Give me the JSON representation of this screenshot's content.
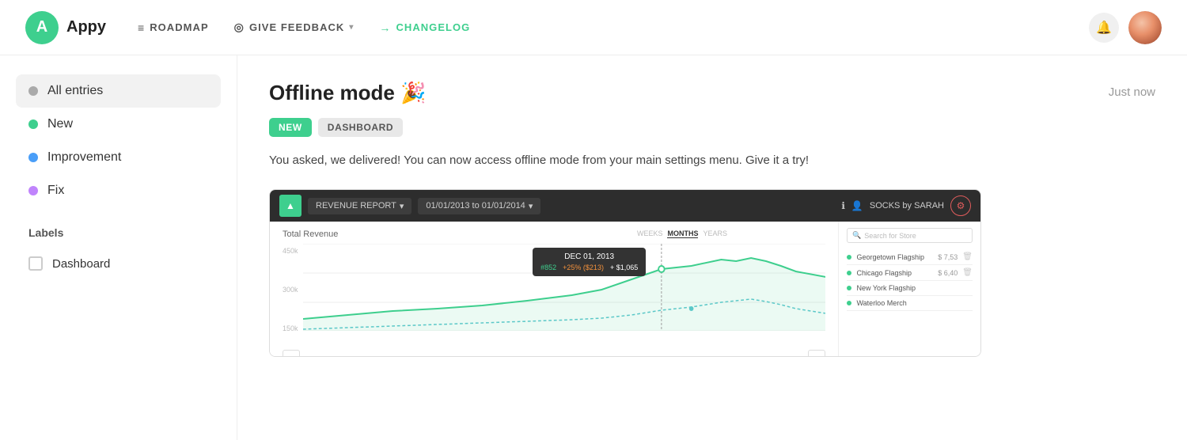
{
  "header": {
    "logo_letter": "A",
    "logo_name": "Appy",
    "nav": [
      {
        "id": "roadmap",
        "label": "ROADMAP",
        "icon": "≡",
        "active": false
      },
      {
        "id": "give-feedback",
        "label": "GIVE FEEDBACK",
        "icon": "◎",
        "has_chevron": true,
        "active": false
      },
      {
        "id": "changelog",
        "label": "CHANGELOG",
        "icon": "→",
        "active": true
      }
    ]
  },
  "sidebar": {
    "filter_items": [
      {
        "id": "all-entries",
        "label": "All entries",
        "dot_class": "dot-gray",
        "active": true
      },
      {
        "id": "new",
        "label": "New",
        "dot_class": "dot-green",
        "active": false
      },
      {
        "id": "improvement",
        "label": "Improvement",
        "dot_class": "dot-blue",
        "active": false
      },
      {
        "id": "fix",
        "label": "Fix",
        "dot_class": "dot-purple",
        "active": false
      }
    ],
    "labels_title": "Labels",
    "label_items": [
      {
        "id": "dashboard",
        "label": "Dashboard",
        "checked": false
      }
    ]
  },
  "entry": {
    "title": "Offline mode 🎉",
    "timestamp": "Just now",
    "tags": [
      {
        "id": "new-tag",
        "label": "NEW",
        "type": "new"
      },
      {
        "id": "dashboard-tag",
        "label": "DASHBOARD",
        "type": "dashboard"
      }
    ],
    "description": "You asked, we delivered! You can now access offline mode from your main settings menu. Give it a try!"
  },
  "app_screenshot": {
    "toolbar": {
      "report_label": "REVENUE REPORT",
      "date_range": "01/01/2013 to 01/01/2014",
      "store_name": "SOCKS by SARAH"
    },
    "chart": {
      "title": "Total Revenue",
      "tabs": [
        "WEEKS",
        "MONTHS",
        "YEARS"
      ],
      "active_tab": "MONTHS",
      "y_labels": [
        "450k",
        "300k",
        "150k"
      ],
      "tooltip": {
        "date": "DEC 01, 2013",
        "values": [
          "#852",
          "+25% ($213)",
          "+ $1,065"
        ]
      }
    },
    "stores": [
      {
        "name": "Georgetown Flagship",
        "value": "$ 7,53"
      },
      {
        "name": "Chicago Flagship",
        "value": "$ 6,40"
      },
      {
        "name": "New York Flagship",
        "value": ""
      },
      {
        "name": "Waterloo Merch",
        "value": ""
      }
    ],
    "search_placeholder": "Search for Store"
  }
}
